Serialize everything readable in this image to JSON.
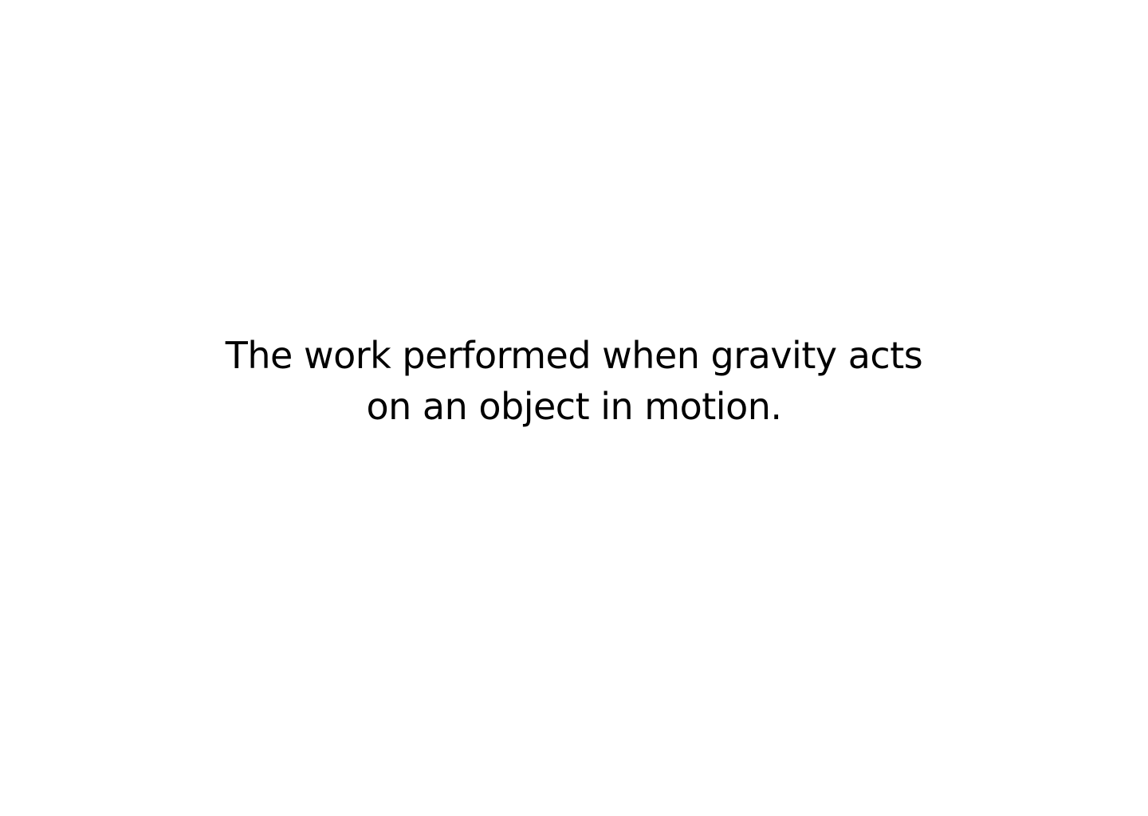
{
  "card": {
    "definition_lines": [
      "The work performed when gravity acts",
      "on an object in motion."
    ]
  },
  "colors": {
    "background": "#ffffff",
    "text": "#000000"
  }
}
